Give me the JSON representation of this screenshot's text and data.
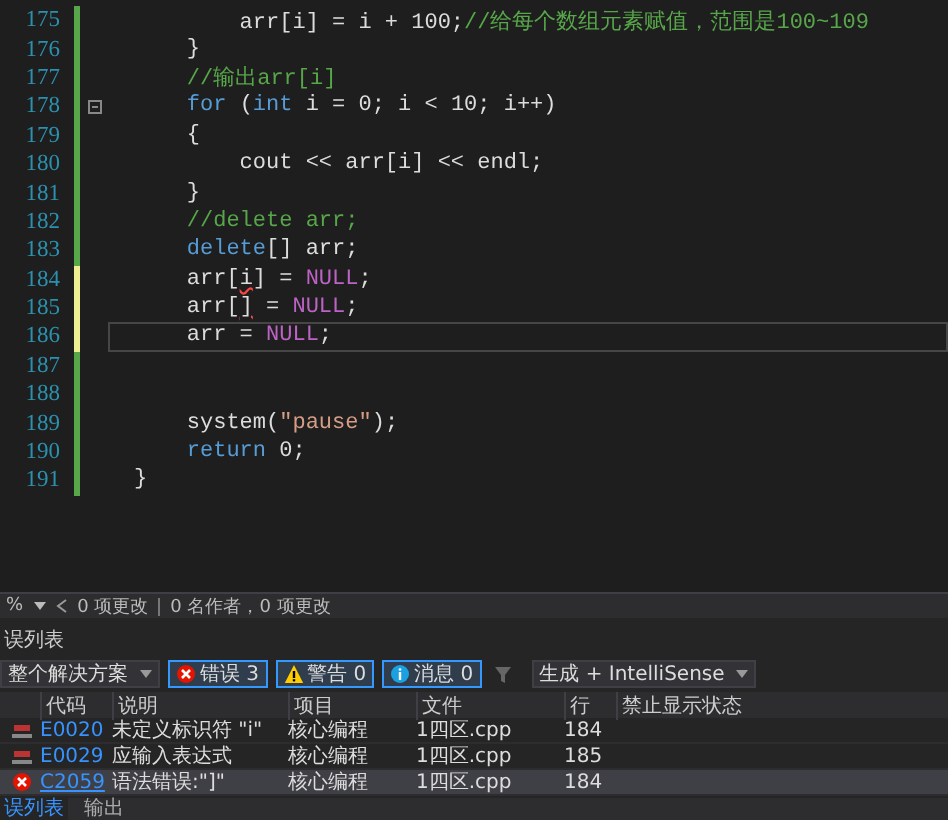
{
  "editor": {
    "lines": [
      {
        "number": "175",
        "modified": false,
        "current": false,
        "fold": false,
        "tokens": [
          {
            "kind": "plain",
            "text": "        arr[i] = i + 100;"
          },
          {
            "kind": "comment",
            "text": "//给每个数组元素赋值，范围是100~109"
          }
        ]
      },
      {
        "number": "176",
        "modified": false,
        "current": false,
        "fold": false,
        "tokens": [
          {
            "kind": "plain",
            "text": "    }"
          }
        ]
      },
      {
        "number": "177",
        "modified": false,
        "current": false,
        "fold": false,
        "tokens": [
          {
            "kind": "comment",
            "text": "    //输出arr[i]"
          }
        ]
      },
      {
        "number": "178",
        "modified": false,
        "current": false,
        "fold": true,
        "tokens": [
          {
            "kind": "keyword",
            "text": "    for"
          },
          {
            "kind": "plain",
            "text": " ("
          },
          {
            "kind": "keyword",
            "text": "int"
          },
          {
            "kind": "plain",
            "text": " i = 0; i < 10; i++)"
          }
        ]
      },
      {
        "number": "179",
        "modified": false,
        "current": false,
        "fold": false,
        "tokens": [
          {
            "kind": "plain",
            "text": "    {"
          }
        ]
      },
      {
        "number": "180",
        "modified": false,
        "current": false,
        "fold": false,
        "tokens": [
          {
            "kind": "plain",
            "text": "        cout << arr[i] << endl;"
          }
        ]
      },
      {
        "number": "181",
        "modified": false,
        "current": false,
        "fold": false,
        "tokens": [
          {
            "kind": "plain",
            "text": "    }"
          }
        ]
      },
      {
        "number": "182",
        "modified": false,
        "current": false,
        "fold": false,
        "tokens": [
          {
            "kind": "comment",
            "text": "    //delete arr;"
          }
        ]
      },
      {
        "number": "183",
        "modified": false,
        "current": false,
        "fold": false,
        "tokens": [
          {
            "kind": "keyword",
            "text": "    delete"
          },
          {
            "kind": "plain",
            "text": "[] arr;"
          }
        ]
      },
      {
        "number": "184",
        "modified": true,
        "current": false,
        "fold": false,
        "tokens": [
          {
            "kind": "plain",
            "text": "    arr["
          },
          {
            "kind": "error",
            "text": "i"
          },
          {
            "kind": "plain",
            "text": "] = "
          },
          {
            "kind": "macro",
            "text": "NULL"
          },
          {
            "kind": "plain",
            "text": ";"
          }
        ]
      },
      {
        "number": "185",
        "modified": true,
        "current": false,
        "fold": false,
        "tokens": [
          {
            "kind": "plain",
            "text": "    arr["
          },
          {
            "kind": "error",
            "text": "]"
          },
          {
            "kind": "plain",
            "text": " = "
          },
          {
            "kind": "macro",
            "text": "NULL"
          },
          {
            "kind": "plain",
            "text": ";"
          }
        ]
      },
      {
        "number": "186",
        "modified": true,
        "current": true,
        "fold": false,
        "tokens": [
          {
            "kind": "plain",
            "text": "    arr = "
          },
          {
            "kind": "macro",
            "text": "NULL"
          },
          {
            "kind": "plain",
            "text": ";"
          }
        ]
      },
      {
        "number": "187",
        "modified": false,
        "current": false,
        "fold": false
      },
      {
        "number": "188",
        "modified": false,
        "current": false,
        "fold": false
      },
      {
        "number": "189",
        "modified": false,
        "current": false,
        "fold": false,
        "tokens": [
          {
            "kind": "plain",
            "text": "    system("
          },
          {
            "kind": "string",
            "text": "\"pause\""
          },
          {
            "kind": "plain",
            "text": ");"
          }
        ]
      },
      {
        "number": "190",
        "modified": false,
        "current": false,
        "fold": false,
        "tokens": [
          {
            "kind": "keyword",
            "text": "    return"
          },
          {
            "kind": "plain",
            "text": " 0;"
          }
        ]
      },
      {
        "number": "191",
        "modified": false,
        "current": false,
        "fold": false,
        "tokens": [
          {
            "kind": "plain",
            "text": "}"
          }
        ]
      }
    ]
  },
  "status_bar": {
    "zoom": "%",
    "changes": "0 项更改",
    "authors": "0 名作者，0 项更改"
  },
  "error_list": {
    "title": "误列表",
    "scope": "整个解决方案",
    "filters": [
      {
        "kind": "error",
        "label": "错误 3",
        "selected": true
      },
      {
        "kind": "warning",
        "label": "警告 0",
        "selected": true
      },
      {
        "kind": "message",
        "label": "消息 0",
        "selected": true
      }
    ],
    "source": "生成 + IntelliSense",
    "columns": [
      "代码",
      "说明",
      "项目",
      "文件",
      "行",
      "禁止显示状态"
    ],
    "rows": [
      {
        "kind": "intellisense",
        "code": "E0020",
        "description": "未定义标识符 \"i\"",
        "project": "核心编程",
        "file": "1四区.cpp",
        "line": "184",
        "selected": false
      },
      {
        "kind": "intellisense",
        "code": "E0029",
        "description": "应输入表达式",
        "project": "核心编程",
        "file": "1四区.cpp",
        "line": "185",
        "selected": false
      },
      {
        "kind": "build",
        "code": "C2059",
        "description": "语法错误:\"]\"",
        "project": "核心编程",
        "file": "1四区.cpp",
        "line": "184",
        "selected": true
      }
    ]
  },
  "bottom_tabs": [
    {
      "label": "误列表",
      "selected": true
    },
    {
      "label": "输出",
      "selected": false
    }
  ]
}
